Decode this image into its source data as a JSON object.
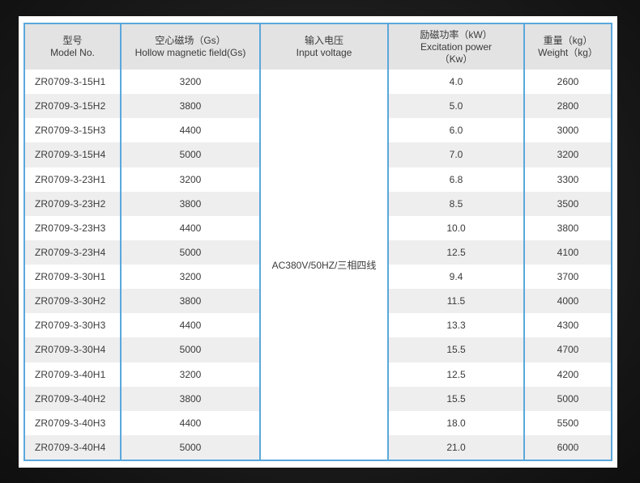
{
  "headers": {
    "model": {
      "zh": "型号",
      "en": "Model No."
    },
    "field": {
      "zh": "空心磁场（Gs）",
      "en": "Hollow magnetic field(Gs)"
    },
    "voltage": {
      "zh": "输入电压",
      "en": "Input voltage"
    },
    "power": {
      "zh": "励磁功率（kW）",
      "en": "Excitation power",
      "unit": "（Kw）"
    },
    "weight": {
      "zh": "重量（kg）",
      "en": "Weight（kg）"
    }
  },
  "input_voltage": "AC380V/50HZ/三相四线",
  "rows": [
    {
      "model": "ZR0709-3-15H1",
      "field": "3200",
      "power": "4.0",
      "weight": "2600"
    },
    {
      "model": "ZR0709-3-15H2",
      "field": "3800",
      "power": "5.0",
      "weight": "2800"
    },
    {
      "model": "ZR0709-3-15H3",
      "field": "4400",
      "power": "6.0",
      "weight": "3000"
    },
    {
      "model": "ZR0709-3-15H4",
      "field": "5000",
      "power": "7.0",
      "weight": "3200"
    },
    {
      "model": "ZR0709-3-23H1",
      "field": "3200",
      "power": "6.8",
      "weight": "3300"
    },
    {
      "model": "ZR0709-3-23H2",
      "field": "3800",
      "power": "8.5",
      "weight": "3500"
    },
    {
      "model": "ZR0709-3-23H3",
      "field": "4400",
      "power": "10.0",
      "weight": "3800"
    },
    {
      "model": "ZR0709-3-23H4",
      "field": "5000",
      "power": "12.5",
      "weight": "4100"
    },
    {
      "model": "ZR0709-3-30H1",
      "field": "3200",
      "power": "9.4",
      "weight": "3700"
    },
    {
      "model": "ZR0709-3-30H2",
      "field": "3800",
      "power": "11.5",
      "weight": "4000"
    },
    {
      "model": "ZR0709-3-30H3",
      "field": "4400",
      "power": "13.3",
      "weight": "4300"
    },
    {
      "model": "ZR0709-3-30H4",
      "field": "5000",
      "power": "15.5",
      "weight": "4700"
    },
    {
      "model": "ZR0709-3-40H1",
      "field": "3200",
      "power": "12.5",
      "weight": "4200"
    },
    {
      "model": "ZR0709-3-40H2",
      "field": "3800",
      "power": "15.5",
      "weight": "5000"
    },
    {
      "model": "ZR0709-3-40H3",
      "field": "4400",
      "power": "18.0",
      "weight": "5500"
    },
    {
      "model": "ZR0709-3-40H4",
      "field": "5000",
      "power": "21.0",
      "weight": "6000"
    }
  ],
  "colors": {
    "border": "#5aa8dc",
    "header_bg": "#e3e3e3",
    "stripe_bg": "#eeeeee",
    "text": "#3a3a3a",
    "page_bg": "#1a1a1a"
  }
}
